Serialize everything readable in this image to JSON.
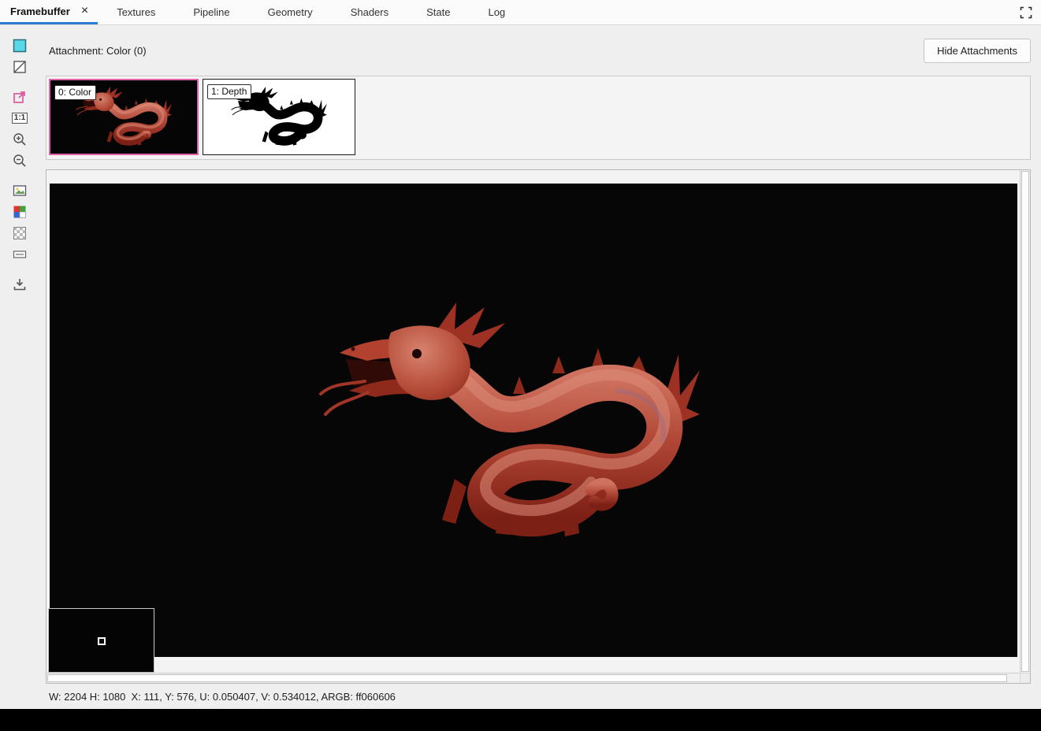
{
  "colors": {
    "accent_blue": "#2e7bd6",
    "selection_pink": "#e061a8",
    "texture_black": "#060606",
    "dragon_red": "#b14736"
  },
  "tabs": {
    "items": [
      {
        "label": "Framebuffer",
        "active": true
      },
      {
        "label": "Textures",
        "active": false
      },
      {
        "label": "Pipeline",
        "active": false
      },
      {
        "label": "Geometry",
        "active": false
      },
      {
        "label": "Shaders",
        "active": false
      },
      {
        "label": "State",
        "active": false
      },
      {
        "label": "Log",
        "active": false
      }
    ],
    "close_glyph": "×"
  },
  "toolbar": {
    "zoom_exact_label": "1:1",
    "icons": [
      "background-color-swatch",
      "no-background",
      "zoom-fit-window",
      "zoom-1-1",
      "zoom-in",
      "zoom-out",
      "image-overlay",
      "rgba-channels",
      "alpha-checkerboard",
      "range-control",
      "save-texture"
    ]
  },
  "attachments": {
    "label": "Attachment: Color (0)",
    "hide_button_label": "Hide Attachments",
    "thumbnails": [
      {
        "label": "0: Color",
        "selected": true
      },
      {
        "label": "1: Depth",
        "selected": false
      }
    ]
  },
  "statusbar": {
    "text": "W: 2204 H: 1080  X: 111, Y: 576, U: 0.050407, V: 0.534012, ARGB: ff060606"
  }
}
